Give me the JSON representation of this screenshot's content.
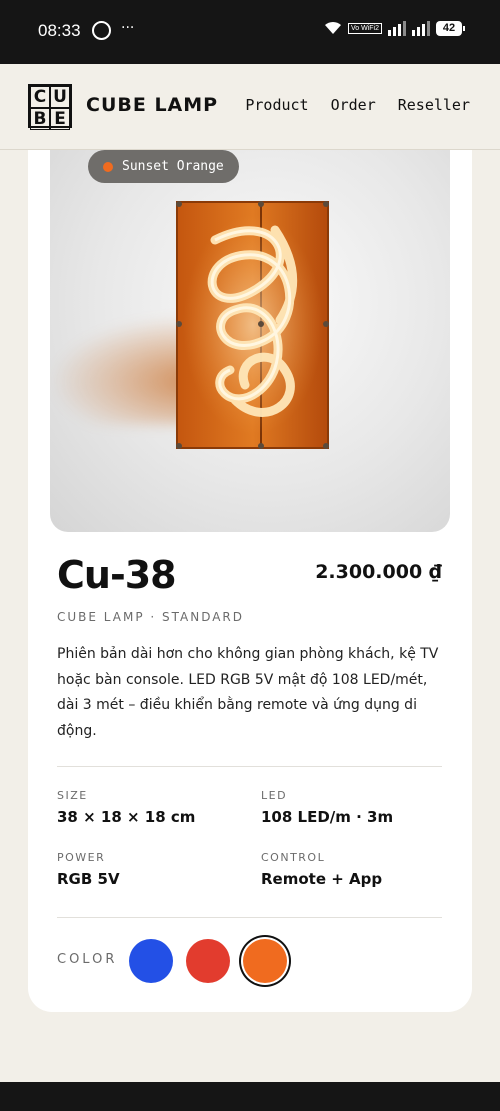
{
  "status": {
    "time": "08:33",
    "vowifi": "Vo WiFi2",
    "battery": "42"
  },
  "header": {
    "logo_letters": [
      "C",
      "U",
      "B",
      "E"
    ],
    "brand": "CUBE LAMP",
    "nav": [
      "Product",
      "Order",
      "Reseller"
    ]
  },
  "product": {
    "badge": "Sunset Orange",
    "name": "Cu-38",
    "price": "2.300.000 ₫",
    "subtitle": "CUBE LAMP · STANDARD",
    "description": "Phiên bản dài hơn cho không gian phòng khách, kệ TV hoặc bàn console. LED RGB 5V mật độ 108 LED/mét, dài 3 mét – điều khiển bằng remote và ứng dụng di động.",
    "specs": {
      "size_label": "SIZE",
      "size_value": "38 × 18 × 18 cm",
      "led_label": "LED",
      "led_value": "108 LED/m · 3m",
      "power_label": "POWER",
      "power_value": "RGB 5V",
      "control_label": "CONTROL",
      "control_value": "Remote + App"
    },
    "color_label": "COLOR",
    "colors": [
      "#2350e6",
      "#e23c2e",
      "#f06b1f"
    ],
    "selected_color": "#f06b1f"
  }
}
